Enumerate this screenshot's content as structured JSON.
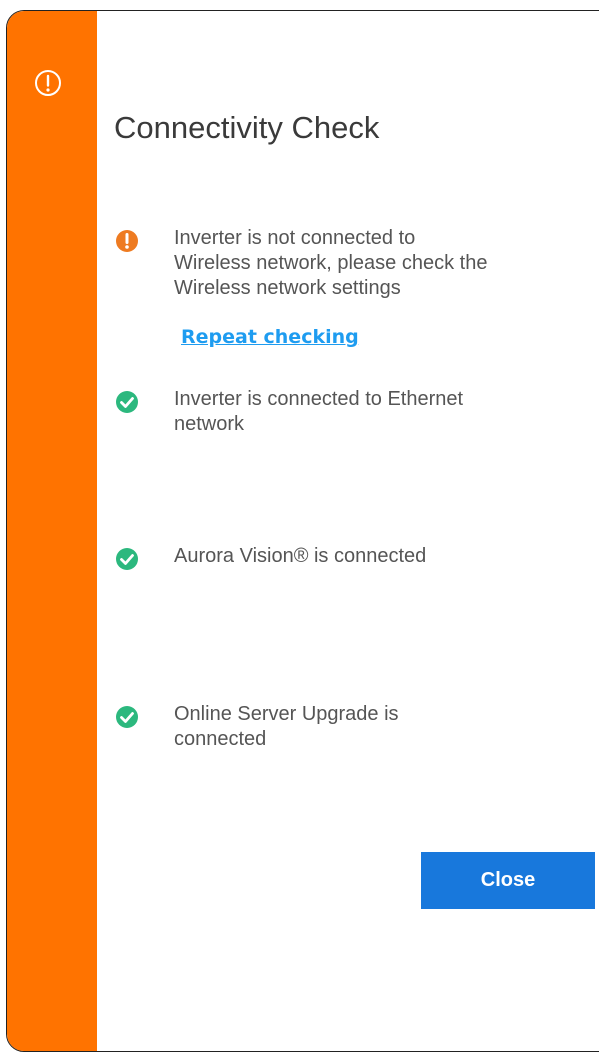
{
  "dialog": {
    "title": "Connectivity Check",
    "header_icon": "exclamation-circle-outline-icon",
    "accent_color": "#ff7300"
  },
  "checks": [
    {
      "status": "error",
      "icon": "exclamation-circle-icon",
      "text": "Inverter is not connected to\nWireless network, please check the\nWireless network settings",
      "action_label": "Repeat checking"
    },
    {
      "status": "ok",
      "icon": "check-circle-icon",
      "text": "Inverter is connected to Ethernet\nnetwork"
    },
    {
      "status": "ok",
      "icon": "check-circle-icon",
      "text": "Aurora Vision® is connected"
    },
    {
      "status": "ok",
      "icon": "check-circle-icon",
      "text": "Online Server Upgrade is\nconnected"
    }
  ],
  "colors": {
    "error": "#ee7b21",
    "ok": "#2cb87e",
    "link": "#1e9cf0",
    "button": "#1878dc"
  },
  "buttons": {
    "close_label": "Close"
  }
}
